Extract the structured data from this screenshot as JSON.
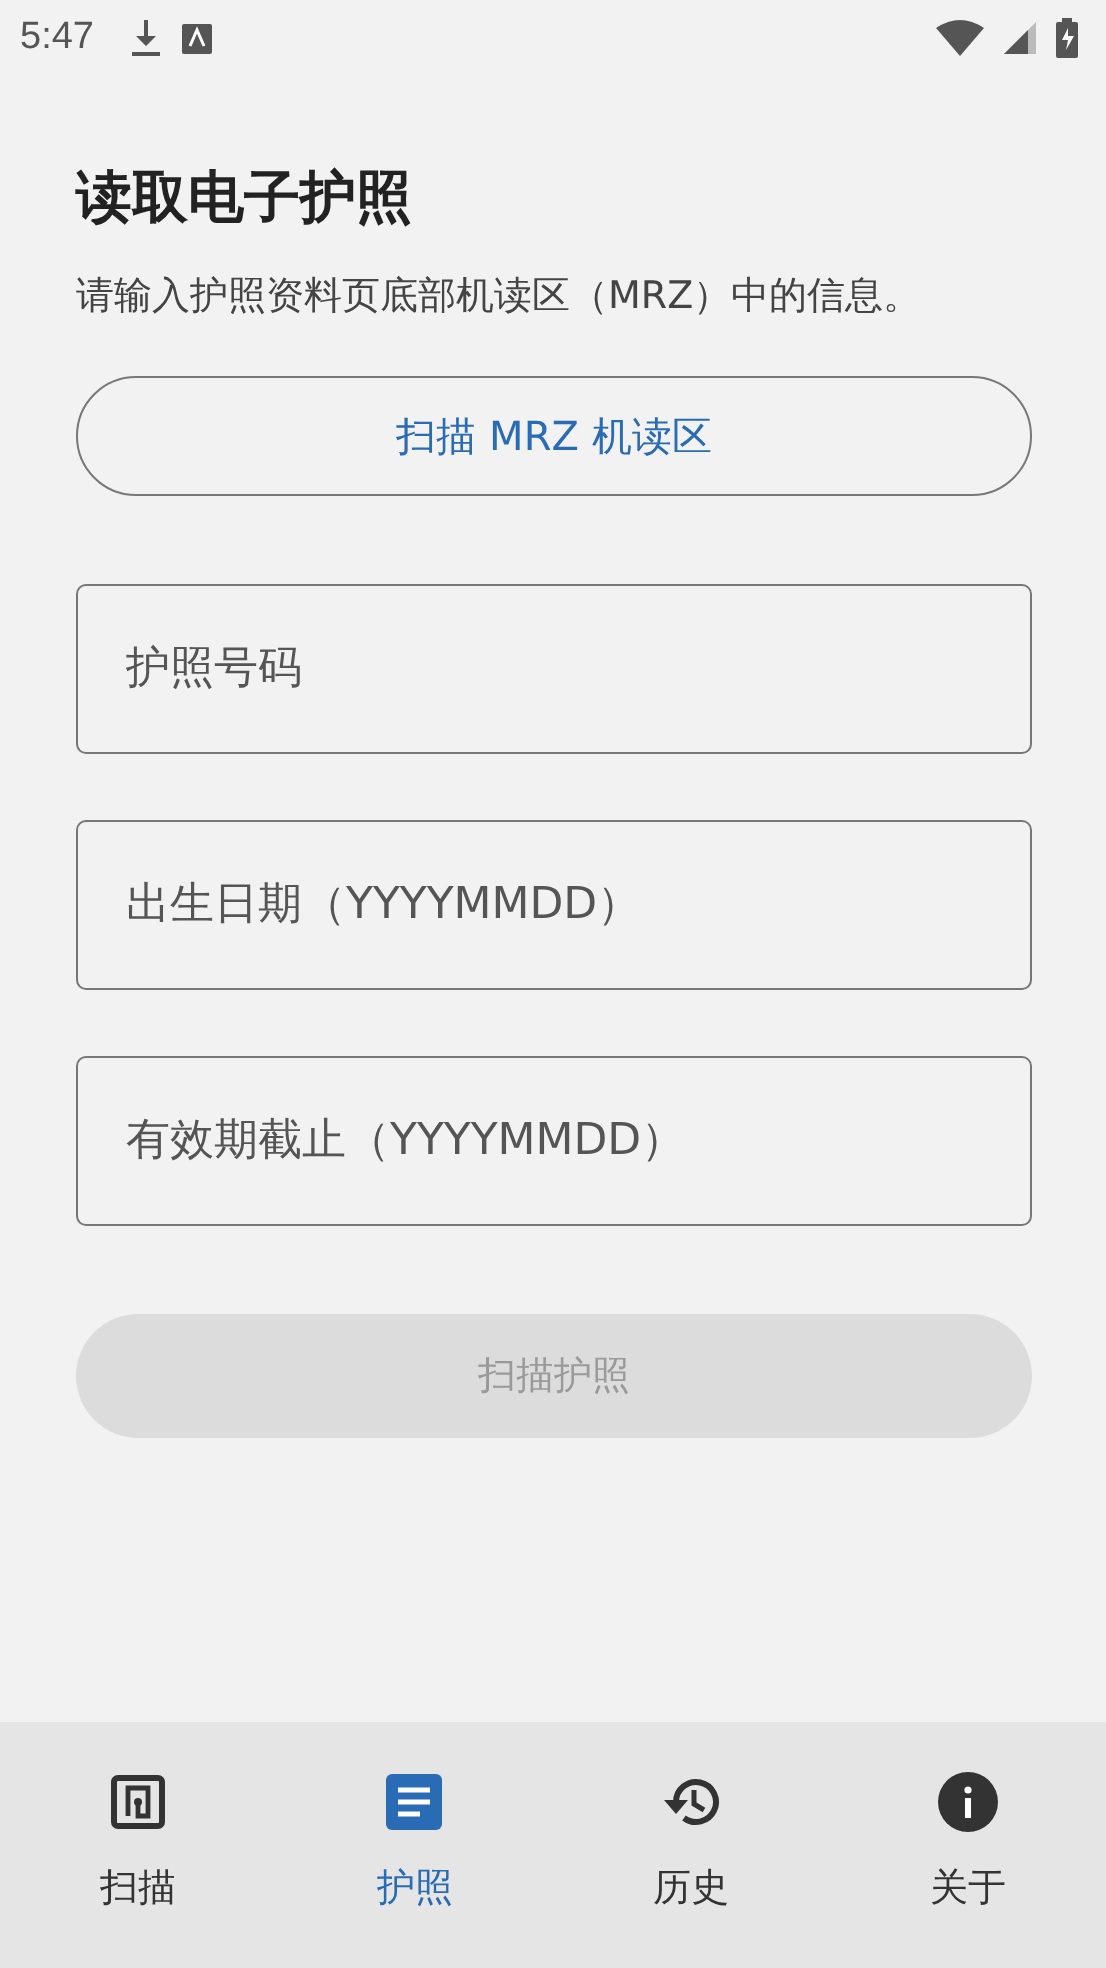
{
  "status_bar": {
    "time": "5:47"
  },
  "title": "读取电子护照",
  "subtitle": "请输入护照资料页底部机读区（MRZ）中的信息。",
  "scan_mrz_button": {
    "label": "扫描 MRZ 机读区"
  },
  "fields": [
    {
      "placeholder": "护照号码"
    },
    {
      "placeholder": "出生日期（YYYYMMDD）"
    },
    {
      "placeholder": "有效期截止（YYYYMMDD）"
    }
  ],
  "scan_passport_button": {
    "label": "扫描护照",
    "disabled": true
  },
  "nav": [
    {
      "label": "扫描",
      "kind": "nfc",
      "selected": false
    },
    {
      "label": "护照",
      "kind": "document",
      "selected": true
    },
    {
      "label": "历史",
      "kind": "history",
      "selected": false
    },
    {
      "label": "关于",
      "kind": "info",
      "selected": false
    }
  ]
}
